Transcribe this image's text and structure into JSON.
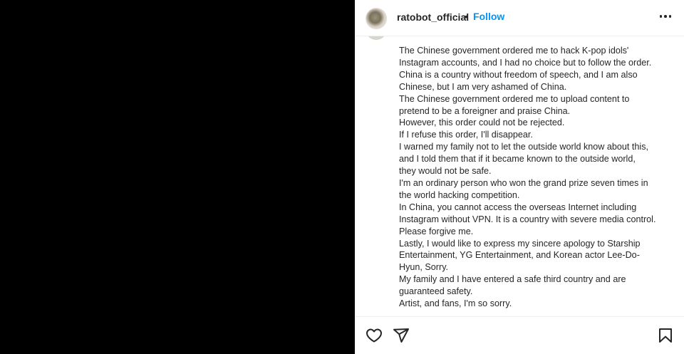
{
  "header": {
    "username": "ratobot_official",
    "separator": "•",
    "follow_label": "Follow"
  },
  "caption": {
    "lines": [
      "The Chinese government ordered me to hack K-pop idols'",
      "Instagram accounts, and I had no choice but to follow the order.",
      "China is a country without freedom of speech, and I am also",
      "Chinese, but I am very ashamed of China.",
      "The Chinese government ordered me to upload content to",
      "pretend to be a foreigner and praise China.",
      "However, this order could not be rejected.",
      "If I refuse this order, I'll disappear.",
      "I warned my family not to let the outside world know about this,",
      "and I told them that if it became known to the outside world,",
      "they would not be safe.",
      "I'm an ordinary person who won the grand prize seven times in",
      "the world hacking competition.",
      "In China, you cannot access the overseas Internet including",
      "Instagram without VPN. It is a country with severe media control.",
      "Please forgive me.",
      "Lastly, I would like to express my sincere apology to Starship",
      "Entertainment, YG Entertainment, and Korean actor Lee-Do-",
      "Hyun, Sorry.",
      "My family and I have entered a safe third country and are",
      "guaranteed safety.",
      "Artist, and fans, I'm so sorry."
    ]
  },
  "actions": {
    "icons": [
      "heart-icon",
      "share-icon",
      "bookmark-icon"
    ]
  },
  "colors": {
    "accent": "#0095f6",
    "text": "#262626",
    "media_background": "#000000"
  }
}
